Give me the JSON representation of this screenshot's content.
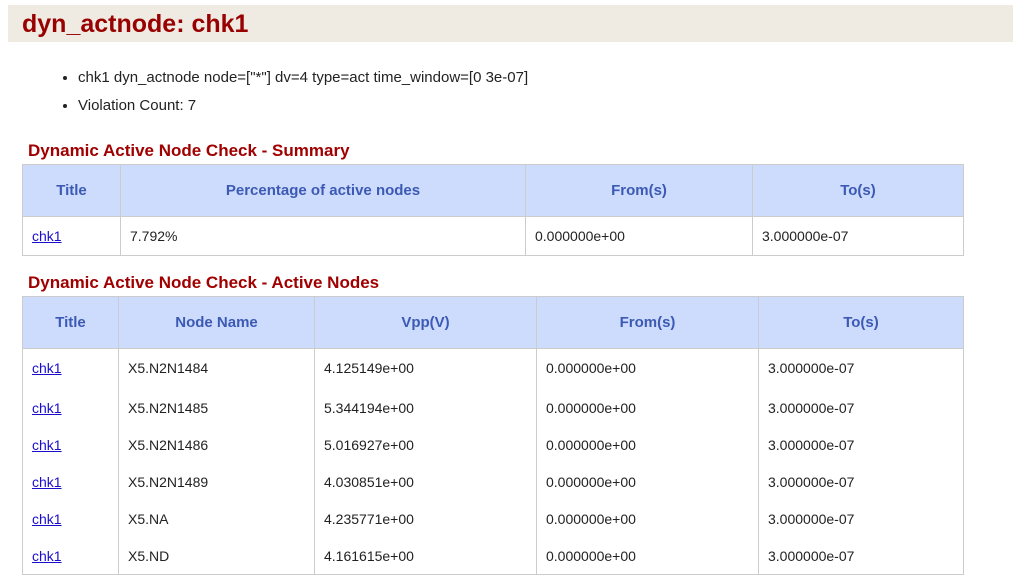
{
  "page_title": "dyn_actnode: chk1",
  "bullets": [
    "chk1 dyn_actnode node=[\"*\"] dv=4 type=act time_window=[0 3e-07]",
    "Violation Count: 7"
  ],
  "summary": {
    "heading": "Dynamic Active Node Check - Summary",
    "columns": [
      "Title",
      "Percentage of active nodes",
      "From(s)",
      "To(s)"
    ],
    "rows": [
      [
        "chk1",
        "7.792%",
        "0.000000e+00",
        "3.000000e-07"
      ]
    ]
  },
  "active_nodes": {
    "heading": "Dynamic Active Node Check - Active Nodes",
    "columns": [
      "Title",
      "Node Name",
      "Vpp(V)",
      "From(s)",
      "To(s)"
    ],
    "rows": [
      [
        "chk1",
        "X5.N2N1484",
        "4.125149e+00",
        "0.000000e+00",
        "3.000000e-07"
      ],
      [
        "chk1",
        "X5.N2N1485",
        "5.344194e+00",
        "0.000000e+00",
        "3.000000e-07"
      ],
      [
        "chk1",
        "X5.N2N1486",
        "5.016927e+00",
        "0.000000e+00",
        "3.000000e-07"
      ],
      [
        "chk1",
        "X5.N2N1489",
        "4.030851e+00",
        "0.000000e+00",
        "3.000000e-07"
      ],
      [
        "chk1",
        "X5.NA",
        "4.235771e+00",
        "0.000000e+00",
        "3.000000e-07"
      ],
      [
        "chk1",
        "X5.ND",
        "4.161615e+00",
        "0.000000e+00",
        "3.000000e-07"
      ]
    ]
  }
}
